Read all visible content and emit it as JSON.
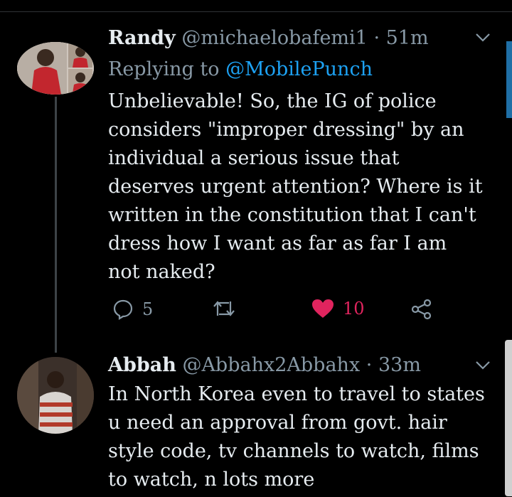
{
  "tweets": [
    {
      "name": "Randy",
      "handle": "@michaelobafemi1",
      "separator": "·",
      "time": "51m",
      "replying_prefix": "Replying to",
      "replying_to": "@MobilePunch",
      "text": "Unbelievable! So, the IG of police\nconsiders \"improper dressing\"  by an\nindividual a serious issue that\ndeserves urgent attention? Where is it\nwritten in the constitution that I can't\ndress how I want as far as far I am\nnot naked?",
      "replies": "5",
      "likes": "10"
    },
    {
      "name": "Abbah",
      "handle": "@Abbahx2Abbahx",
      "separator": "·",
      "time": "33m",
      "text": "In North Korea even to travel to states\nu need an approval from govt. hair\nstyle code, tv channels to watch, films\nto watch, n lots more"
    }
  ],
  "colors": {
    "background": "#000000",
    "text": "#e6ecf0",
    "secondary": "#8899a6",
    "mention": "#1da1f2",
    "like": "#e0245e"
  },
  "icons": [
    "reply-icon",
    "retweet-icon",
    "heart-icon",
    "share-icon",
    "chevron-down-icon"
  ]
}
